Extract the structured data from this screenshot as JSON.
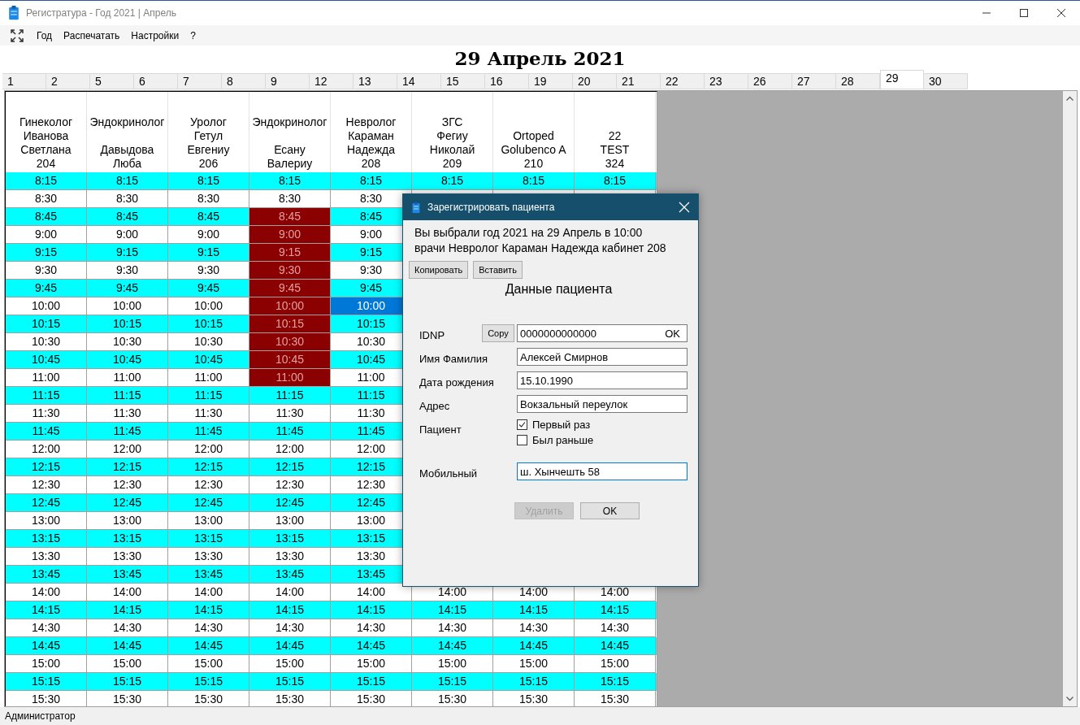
{
  "window": {
    "title": "Регистратура - Год 2021 | Апрель"
  },
  "menu": [
    {
      "label": "Год"
    },
    {
      "label": "Распечатать"
    },
    {
      "label": "Настройки"
    },
    {
      "label": "?"
    }
  ],
  "date_heading": "29 Апрель 2021",
  "day_tabs": [
    {
      "label": "1",
      "selected": false
    },
    {
      "label": "2",
      "selected": false
    },
    {
      "label": "5",
      "selected": false
    },
    {
      "label": "6",
      "selected": false
    },
    {
      "label": "7",
      "selected": false
    },
    {
      "label": "8",
      "selected": false
    },
    {
      "label": "9",
      "selected": false
    },
    {
      "label": "12",
      "selected": false
    },
    {
      "label": "13",
      "selected": false
    },
    {
      "label": "14",
      "selected": false
    },
    {
      "label": "15",
      "selected": false
    },
    {
      "label": "16",
      "selected": false
    },
    {
      "label": "19",
      "selected": false
    },
    {
      "label": "20",
      "selected": false
    },
    {
      "label": "21",
      "selected": false
    },
    {
      "label": "22",
      "selected": false
    },
    {
      "label": "23",
      "selected": false
    },
    {
      "label": "26",
      "selected": false
    },
    {
      "label": "27",
      "selected": false
    },
    {
      "label": "28",
      "selected": false
    },
    {
      "label": "29",
      "selected": true
    },
    {
      "label": "30",
      "selected": false
    }
  ],
  "schedule": {
    "columns": [
      "Гинеколог\nИванова\nСветлана\n204",
      "Эндокринолог\n\nДавыдова\nЛюба",
      "Уролог\nГетул\nЕвгениу\n206",
      "Эндокринолог\n\nЕсану\nВалериу",
      "Невролог\nКараман\nНадежда\n208",
      "ЗГС\nФегиу\nНиколай\n209",
      "Ortoped\nGolubenco A\n210",
      "22\nTEST\n324"
    ],
    "rows": [
      {
        "cells": [
          {
            "text": "8:15",
            "booked": false,
            "selected": false
          },
          {
            "text": "8:15",
            "booked": false,
            "selected": false
          },
          {
            "text": "8:15",
            "booked": false,
            "selected": false
          },
          {
            "text": "8:15",
            "booked": false,
            "selected": false
          },
          {
            "text": "8:15",
            "booked": false,
            "selected": false
          },
          {
            "text": "8:15",
            "booked": false,
            "selected": false
          },
          {
            "text": "8:15",
            "booked": false,
            "selected": false
          },
          {
            "text": "8:15",
            "booked": false,
            "selected": false
          }
        ]
      },
      {
        "cells": [
          {
            "text": "8:30",
            "booked": false,
            "selected": false
          },
          {
            "text": "8:30",
            "booked": false,
            "selected": false
          },
          {
            "text": "8:30",
            "booked": false,
            "selected": false
          },
          {
            "text": "8:30",
            "booked": false,
            "selected": false
          },
          {
            "text": "8:30",
            "booked": false,
            "selected": false
          }
        ]
      },
      {
        "cells": [
          {
            "text": "8:45",
            "booked": false,
            "selected": false
          },
          {
            "text": "8:45",
            "booked": false,
            "selected": false
          },
          {
            "text": "8:45",
            "booked": false,
            "selected": false
          },
          {
            "text": "8:45",
            "booked": true,
            "selected": false
          },
          {
            "text": "8:45",
            "booked": false,
            "selected": false
          }
        ]
      },
      {
        "cells": [
          {
            "text": "9:00",
            "booked": false,
            "selected": false
          },
          {
            "text": "9:00",
            "booked": false,
            "selected": false
          },
          {
            "text": "9:00",
            "booked": false,
            "selected": false
          },
          {
            "text": "9:00",
            "booked": true,
            "selected": false
          },
          {
            "text": "9:00",
            "booked": false,
            "selected": false
          }
        ]
      },
      {
        "cells": [
          {
            "text": "9:15",
            "booked": false,
            "selected": false
          },
          {
            "text": "9:15",
            "booked": false,
            "selected": false
          },
          {
            "text": "9:15",
            "booked": false,
            "selected": false
          },
          {
            "text": "9:15",
            "booked": true,
            "selected": false
          },
          {
            "text": "9:15",
            "booked": false,
            "selected": false
          }
        ]
      },
      {
        "cells": [
          {
            "text": "9:30",
            "booked": false,
            "selected": false
          },
          {
            "text": "9:30",
            "booked": false,
            "selected": false
          },
          {
            "text": "9:30",
            "booked": false,
            "selected": false
          },
          {
            "text": "9:30",
            "booked": true,
            "selected": false
          },
          {
            "text": "9:30",
            "booked": false,
            "selected": false
          }
        ]
      },
      {
        "cells": [
          {
            "text": "9:45",
            "booked": false,
            "selected": false
          },
          {
            "text": "9:45",
            "booked": false,
            "selected": false
          },
          {
            "text": "9:45",
            "booked": false,
            "selected": false
          },
          {
            "text": "9:45",
            "booked": true,
            "selected": false
          },
          {
            "text": "9:45",
            "booked": false,
            "selected": false
          }
        ]
      },
      {
        "cells": [
          {
            "text": "10:00",
            "booked": false,
            "selected": false
          },
          {
            "text": "10:00",
            "booked": false,
            "selected": false
          },
          {
            "text": "10:00",
            "booked": false,
            "selected": false
          },
          {
            "text": "10:00",
            "booked": true,
            "selected": false
          },
          {
            "text": "10:00",
            "booked": false,
            "selected": true
          }
        ]
      },
      {
        "cells": [
          {
            "text": "10:15",
            "booked": false,
            "selected": false
          },
          {
            "text": "10:15",
            "booked": false,
            "selected": false
          },
          {
            "text": "10:15",
            "booked": false,
            "selected": false
          },
          {
            "text": "10:15",
            "booked": true,
            "selected": false
          },
          {
            "text": "10:15",
            "booked": false,
            "selected": false
          }
        ]
      },
      {
        "cells": [
          {
            "text": "10:30",
            "booked": false,
            "selected": false
          },
          {
            "text": "10:30",
            "booked": false,
            "selected": false
          },
          {
            "text": "10:30",
            "booked": false,
            "selected": false
          },
          {
            "text": "10:30",
            "booked": true,
            "selected": false
          },
          {
            "text": "10:30",
            "booked": false,
            "selected": false
          }
        ]
      },
      {
        "cells": [
          {
            "text": "10:45",
            "booked": false,
            "selected": false
          },
          {
            "text": "10:45",
            "booked": false,
            "selected": false
          },
          {
            "text": "10:45",
            "booked": false,
            "selected": false
          },
          {
            "text": "10:45",
            "booked": true,
            "selected": false
          },
          {
            "text": "10:45",
            "booked": false,
            "selected": false
          }
        ]
      },
      {
        "cells": [
          {
            "text": "11:00",
            "booked": false,
            "selected": false
          },
          {
            "text": "11:00",
            "booked": false,
            "selected": false
          },
          {
            "text": "11:00",
            "booked": false,
            "selected": false
          },
          {
            "text": "11:00",
            "booked": true,
            "selected": false
          },
          {
            "text": "11:00",
            "booked": false,
            "selected": false
          }
        ]
      },
      {
        "cells": [
          {
            "text": "11:15",
            "booked": false,
            "selected": false
          },
          {
            "text": "11:15",
            "booked": false,
            "selected": false
          },
          {
            "text": "11:15",
            "booked": false,
            "selected": false
          },
          {
            "text": "11:15",
            "booked": false,
            "selected": false
          },
          {
            "text": "11:15",
            "booked": false,
            "selected": false
          }
        ]
      },
      {
        "cells": [
          {
            "text": "11:30",
            "booked": false,
            "selected": false
          },
          {
            "text": "11:30",
            "booked": false,
            "selected": false
          },
          {
            "text": "11:30",
            "booked": false,
            "selected": false
          },
          {
            "text": "11:30",
            "booked": false,
            "selected": false
          },
          {
            "text": "11:30",
            "booked": false,
            "selected": false
          }
        ]
      },
      {
        "cells": [
          {
            "text": "11:45",
            "booked": false,
            "selected": false
          },
          {
            "text": "11:45",
            "booked": false,
            "selected": false
          },
          {
            "text": "11:45",
            "booked": false,
            "selected": false
          },
          {
            "text": "11:45",
            "booked": false,
            "selected": false
          },
          {
            "text": "11:45",
            "booked": false,
            "selected": false
          }
        ]
      },
      {
        "cells": [
          {
            "text": "12:00",
            "booked": false,
            "selected": false
          },
          {
            "text": "12:00",
            "booked": false,
            "selected": false
          },
          {
            "text": "12:00",
            "booked": false,
            "selected": false
          },
          {
            "text": "12:00",
            "booked": false,
            "selected": false
          },
          {
            "text": "12:00",
            "booked": false,
            "selected": false
          }
        ]
      },
      {
        "cells": [
          {
            "text": "12:15",
            "booked": false,
            "selected": false
          },
          {
            "text": "12:15",
            "booked": false,
            "selected": false
          },
          {
            "text": "12:15",
            "booked": false,
            "selected": false
          },
          {
            "text": "12:15",
            "booked": false,
            "selected": false
          },
          {
            "text": "12:15",
            "booked": false,
            "selected": false
          }
        ]
      },
      {
        "cells": [
          {
            "text": "12:30",
            "booked": false,
            "selected": false
          },
          {
            "text": "12:30",
            "booked": false,
            "selected": false
          },
          {
            "text": "12:30",
            "booked": false,
            "selected": false
          },
          {
            "text": "12:30",
            "booked": false,
            "selected": false
          },
          {
            "text": "12:30",
            "booked": false,
            "selected": false
          }
        ]
      },
      {
        "cells": [
          {
            "text": "12:45",
            "booked": false,
            "selected": false
          },
          {
            "text": "12:45",
            "booked": false,
            "selected": false
          },
          {
            "text": "12:45",
            "booked": false,
            "selected": false
          },
          {
            "text": "12:45",
            "booked": false,
            "selected": false
          },
          {
            "text": "12:45",
            "booked": false,
            "selected": false
          }
        ]
      },
      {
        "cells": [
          {
            "text": "13:00",
            "booked": false,
            "selected": false
          },
          {
            "text": "13:00",
            "booked": false,
            "selected": false
          },
          {
            "text": "13:00",
            "booked": false,
            "selected": false
          },
          {
            "text": "13:00",
            "booked": false,
            "selected": false
          },
          {
            "text": "13:00",
            "booked": false,
            "selected": false
          }
        ]
      },
      {
        "cells": [
          {
            "text": "13:15",
            "booked": false,
            "selected": false
          },
          {
            "text": "13:15",
            "booked": false,
            "selected": false
          },
          {
            "text": "13:15",
            "booked": false,
            "selected": false
          },
          {
            "text": "13:15",
            "booked": false,
            "selected": false
          },
          {
            "text": "13:15",
            "booked": false,
            "selected": false
          }
        ]
      },
      {
        "cells": [
          {
            "text": "13:30",
            "booked": false,
            "selected": false
          },
          {
            "text": "13:30",
            "booked": false,
            "selected": false
          },
          {
            "text": "13:30",
            "booked": false,
            "selected": false
          },
          {
            "text": "13:30",
            "booked": false,
            "selected": false
          },
          {
            "text": "13:30",
            "booked": false,
            "selected": false
          }
        ]
      },
      {
        "cells": [
          {
            "text": "13:45",
            "booked": false,
            "selected": false
          },
          {
            "text": "13:45",
            "booked": false,
            "selected": false
          },
          {
            "text": "13:45",
            "booked": false,
            "selected": false
          },
          {
            "text": "13:45",
            "booked": false,
            "selected": false
          },
          {
            "text": "13:45",
            "booked": false,
            "selected": false
          }
        ]
      },
      {
        "cells": [
          {
            "text": "14:00",
            "booked": false,
            "selected": false
          },
          {
            "text": "14:00",
            "booked": false,
            "selected": false
          },
          {
            "text": "14:00",
            "booked": false,
            "selected": false
          },
          {
            "text": "14:00",
            "booked": false,
            "selected": false
          },
          {
            "text": "14:00",
            "booked": false,
            "selected": false
          },
          {
            "text": "14:00",
            "booked": false,
            "selected": false
          },
          {
            "text": "14:00",
            "booked": false,
            "selected": false
          },
          {
            "text": "14:00",
            "booked": false,
            "selected": false
          }
        ]
      },
      {
        "cells": [
          {
            "text": "14:15",
            "booked": false,
            "selected": false
          },
          {
            "text": "14:15",
            "booked": false,
            "selected": false
          },
          {
            "text": "14:15",
            "booked": false,
            "selected": false
          },
          {
            "text": "14:15",
            "booked": false,
            "selected": false
          },
          {
            "text": "14:15",
            "booked": false,
            "selected": false
          },
          {
            "text": "14:15",
            "booked": false,
            "selected": false
          },
          {
            "text": "14:15",
            "booked": false,
            "selected": false
          },
          {
            "text": "14:15",
            "booked": false,
            "selected": false
          }
        ]
      },
      {
        "cells": [
          {
            "text": "14:30",
            "booked": false,
            "selected": false
          },
          {
            "text": "14:30",
            "booked": false,
            "selected": false
          },
          {
            "text": "14:30",
            "booked": false,
            "selected": false
          },
          {
            "text": "14:30",
            "booked": false,
            "selected": false
          },
          {
            "text": "14:30",
            "booked": false,
            "selected": false
          },
          {
            "text": "14:30",
            "booked": false,
            "selected": false
          },
          {
            "text": "14:30",
            "booked": false,
            "selected": false
          },
          {
            "text": "14:30",
            "booked": false,
            "selected": false
          }
        ]
      },
      {
        "cells": [
          {
            "text": "14:45",
            "booked": false,
            "selected": false
          },
          {
            "text": "14:45",
            "booked": false,
            "selected": false
          },
          {
            "text": "14:45",
            "booked": false,
            "selected": false
          },
          {
            "text": "14:45",
            "booked": false,
            "selected": false
          },
          {
            "text": "14:45",
            "booked": false,
            "selected": false
          },
          {
            "text": "14:45",
            "booked": false,
            "selected": false
          },
          {
            "text": "14:45",
            "booked": false,
            "selected": false
          },
          {
            "text": "14:45",
            "booked": false,
            "selected": false
          }
        ]
      },
      {
        "cells": [
          {
            "text": "15:00",
            "booked": false,
            "selected": false
          },
          {
            "text": "15:00",
            "booked": false,
            "selected": false
          },
          {
            "text": "15:00",
            "booked": false,
            "selected": false
          },
          {
            "text": "15:00",
            "booked": false,
            "selected": false
          },
          {
            "text": "15:00",
            "booked": false,
            "selected": false
          },
          {
            "text": "15:00",
            "booked": false,
            "selected": false
          },
          {
            "text": "15:00",
            "booked": false,
            "selected": false
          },
          {
            "text": "15:00",
            "booked": false,
            "selected": false
          }
        ]
      },
      {
        "cells": [
          {
            "text": "15:15",
            "booked": false,
            "selected": false
          },
          {
            "text": "15:15",
            "booked": false,
            "selected": false
          },
          {
            "text": "15:15",
            "booked": false,
            "selected": false
          },
          {
            "text": "15:15",
            "booked": false,
            "selected": false
          },
          {
            "text": "15:15",
            "booked": false,
            "selected": false
          },
          {
            "text": "15:15",
            "booked": false,
            "selected": false
          },
          {
            "text": "15:15",
            "booked": false,
            "selected": false
          },
          {
            "text": "15:15",
            "booked": false,
            "selected": false
          }
        ]
      },
      {
        "cells": [
          {
            "text": "15:30",
            "booked": false,
            "selected": false
          },
          {
            "text": "15:30",
            "booked": false,
            "selected": false
          },
          {
            "text": "15:30",
            "booked": false,
            "selected": false
          },
          {
            "text": "15:30",
            "booked": false,
            "selected": false
          },
          {
            "text": "15:30",
            "booked": false,
            "selected": false
          },
          {
            "text": "15:30",
            "booked": false,
            "selected": false
          },
          {
            "text": "15:30",
            "booked": false,
            "selected": false
          },
          {
            "text": "15:30",
            "booked": false,
            "selected": false
          }
        ]
      }
    ]
  },
  "dialog": {
    "title": "Зарегистрировать пациента",
    "info_lines": [
      "Вы выбрали год 2021 на 29 Апрель в 10:00",
      "врачи Невролог Караман Надежда кабинет 208"
    ],
    "tool_buttons": [
      {
        "label": "Копировать"
      },
      {
        "label": "Вставить"
      }
    ],
    "section_title": "Данные пациента",
    "form": [
      {
        "kind": "text",
        "label": "IDNP",
        "button": "Copy",
        "value": "0000000000000",
        "suffix": "OK",
        "focused": false
      },
      {
        "kind": "text",
        "label": "Имя Фамилия",
        "value": "Алексей Смирнов",
        "focused": false
      },
      {
        "kind": "text",
        "label": "Дата рождения",
        "value": "15.10.1990",
        "focused": false
      },
      {
        "kind": "text",
        "label": "Адрес",
        "value": "Вокзальный переулок",
        "focused": false
      },
      {
        "kind": "checks",
        "label": "Пациент",
        "options": [
          {
            "label": "Первый раз",
            "checked": true
          },
          {
            "label": "Был раньше",
            "checked": false
          }
        ]
      },
      {
        "kind": "text",
        "label": "Мобильный",
        "value": "ш. Хынчешть 58",
        "focused": true
      }
    ],
    "buttons": [
      {
        "label": "Удалить",
        "disabled": true
      },
      {
        "label": "OK",
        "disabled": false
      }
    ]
  },
  "status_bar": "Администратор"
}
